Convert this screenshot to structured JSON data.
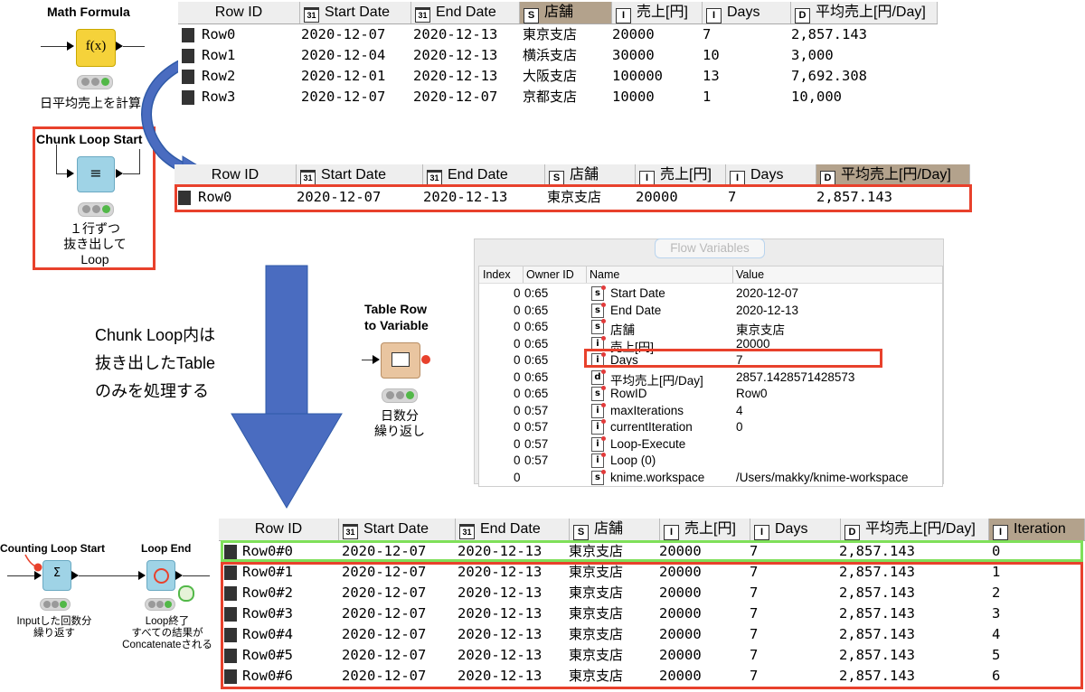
{
  "math_node": {
    "title": "Math Formula",
    "icon": "f(x)",
    "desc": "日平均売上を計算"
  },
  "chunk_node": {
    "title": "Chunk Loop Start",
    "icon": "≡",
    "desc_lines": [
      "１行ずつ",
      "抜き出して",
      "Loop"
    ]
  },
  "table_row_node": {
    "title_lines": [
      "Table Row",
      "to Variable"
    ],
    "desc_lines": [
      "日数分",
      "繰り返し"
    ]
  },
  "counting_node": {
    "title": "Counting Loop Start",
    "icon": "Σ",
    "desc_lines": [
      "Inputした回数分",
      "繰り返す"
    ]
  },
  "loop_end_node": {
    "title": "Loop End",
    "desc_lines": [
      "Loop終了",
      "すべての結果が",
      "Concatenateされる"
    ]
  },
  "note_lines": [
    "Chunk Loop内は",
    "抜き出したTable",
    "のみを処理する"
  ],
  "table1": {
    "columns": [
      {
        "type": "",
        "label": "Row ID"
      },
      {
        "type": "31",
        "label": "Start Date"
      },
      {
        "type": "31",
        "label": "End Date"
      },
      {
        "type": "S",
        "label": "店舗"
      },
      {
        "type": "I",
        "label": "売上[円]"
      },
      {
        "type": "I",
        "label": "Days"
      },
      {
        "type": "D",
        "label": "平均売上[円/Day]"
      }
    ],
    "rows": [
      [
        "Row0",
        "2020-12-07",
        "2020-12-13",
        "東京支店",
        "20000",
        "7",
        "2,857.143"
      ],
      [
        "Row1",
        "2020-12-04",
        "2020-12-13",
        "横浜支店",
        "30000",
        "10",
        "3,000"
      ],
      [
        "Row2",
        "2020-12-01",
        "2020-12-13",
        "大阪支店",
        "100000",
        "13",
        "7,692.308"
      ],
      [
        "Row3",
        "2020-12-07",
        "2020-12-07",
        "京都支店",
        "10000",
        "1",
        "10,000"
      ]
    ]
  },
  "table2": {
    "columns": [
      {
        "type": "",
        "label": "Row ID"
      },
      {
        "type": "31",
        "label": "Start Date"
      },
      {
        "type": "31",
        "label": "End Date"
      },
      {
        "type": "S",
        "label": "店舗"
      },
      {
        "type": "I",
        "label": "売上[円]"
      },
      {
        "type": "I",
        "label": "Days"
      },
      {
        "type": "D",
        "label": "平均売上[円/Day]"
      }
    ],
    "rows": [
      [
        "Row0",
        "2020-12-07",
        "2020-12-13",
        "東京支店",
        "20000",
        "7",
        "2,857.143"
      ]
    ]
  },
  "flow_vars": {
    "title": "Flow Variables",
    "headers": [
      "Index",
      "Owner ID",
      "Name",
      "Value"
    ],
    "rows": [
      {
        "index": "0",
        "owner": "0:65",
        "type": "s",
        "name": "Start Date",
        "value": "2020-12-07"
      },
      {
        "index": "0",
        "owner": "0:65",
        "type": "s",
        "name": "End Date",
        "value": "2020-12-13"
      },
      {
        "index": "0",
        "owner": "0:65",
        "type": "s",
        "name": "店舗",
        "value": "東京支店"
      },
      {
        "index": "0",
        "owner": "0:65",
        "type": "i",
        "name": "売上[円]",
        "value": "20000"
      },
      {
        "index": "0",
        "owner": "0:65",
        "type": "i",
        "name": "Days",
        "value": "7"
      },
      {
        "index": "0",
        "owner": "0:65",
        "type": "d",
        "name": "平均売上[円/Day]",
        "value": "2857.1428571428573"
      },
      {
        "index": "0",
        "owner": "0:65",
        "type": "s",
        "name": "RowID",
        "value": "Row0"
      },
      {
        "index": "0",
        "owner": "0:57",
        "type": "i",
        "name": "maxIterations",
        "value": "4"
      },
      {
        "index": "0",
        "owner": "0:57",
        "type": "i",
        "name": "currentIteration",
        "value": "0"
      },
      {
        "index": "0",
        "owner": "0:57",
        "type": "i",
        "name": "Loop-Execute",
        "value": ""
      },
      {
        "index": "0",
        "owner": "0:57",
        "type": "i",
        "name": "Loop (0)",
        "value": ""
      },
      {
        "index": "0",
        "owner": "",
        "type": "s",
        "name": "knime.workspace",
        "value": "/Users/makky/knime-workspace"
      }
    ]
  },
  "table3": {
    "columns": [
      {
        "type": "",
        "label": "Row ID"
      },
      {
        "type": "31",
        "label": "Start Date"
      },
      {
        "type": "31",
        "label": "End Date"
      },
      {
        "type": "S",
        "label": "店舗"
      },
      {
        "type": "I",
        "label": "売上[円]"
      },
      {
        "type": "I",
        "label": "Days"
      },
      {
        "type": "D",
        "label": "平均売上[円/Day]"
      },
      {
        "type": "I",
        "label": "Iteration"
      }
    ],
    "rows": [
      [
        "Row0#0",
        "2020-12-07",
        "2020-12-13",
        "東京支店",
        "20000",
        "7",
        "2,857.143",
        "0"
      ],
      [
        "Row0#1",
        "2020-12-07",
        "2020-12-13",
        "東京支店",
        "20000",
        "7",
        "2,857.143",
        "1"
      ],
      [
        "Row0#2",
        "2020-12-07",
        "2020-12-13",
        "東京支店",
        "20000",
        "7",
        "2,857.143",
        "2"
      ],
      [
        "Row0#3",
        "2020-12-07",
        "2020-12-13",
        "東京支店",
        "20000",
        "7",
        "2,857.143",
        "3"
      ],
      [
        "Row0#4",
        "2020-12-07",
        "2020-12-13",
        "東京支店",
        "20000",
        "7",
        "2,857.143",
        "4"
      ],
      [
        "Row0#5",
        "2020-12-07",
        "2020-12-13",
        "東京支店",
        "20000",
        "7",
        "2,857.143",
        "5"
      ],
      [
        "Row0#6",
        "2020-12-07",
        "2020-12-13",
        "東京支店",
        "20000",
        "7",
        "2,857.143",
        "6"
      ]
    ]
  },
  "colors": {
    "highlight_red": "#e8412c",
    "highlight_green": "#7fe05a",
    "arrow_blue": "#4a6cc0",
    "math_node": "#f5d23a",
    "loop_node": "#9fd3e6"
  }
}
